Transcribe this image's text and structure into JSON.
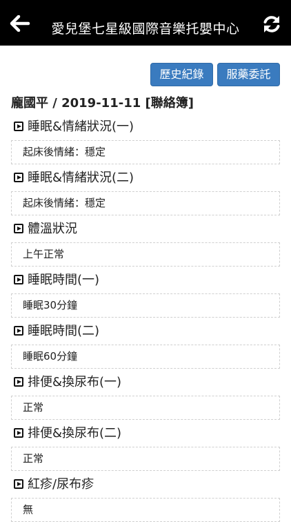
{
  "header": {
    "title": "愛兒堡七星級國際音樂托嬰中心",
    "back_icon": "arrow-left-icon",
    "refresh_icon": "refresh-icon"
  },
  "actions": {
    "history_label": "歷史紀錄",
    "medicine_label": "服藥委託"
  },
  "record": {
    "heading": "龐國平 / 2019-11-11 [聯絡簿]"
  },
  "sections": [
    {
      "title": "睡眠&情緒狀況(一)",
      "value": "起床後情緒：穩定"
    },
    {
      "title": "睡眠&情緒狀況(二)",
      "value": "起床後情緒：穩定"
    },
    {
      "title": "體溫狀況",
      "value": "上午正常"
    },
    {
      "title": "睡眠時間(一)",
      "value": "睡眠30分鐘"
    },
    {
      "title": "睡眠時間(二)",
      "value": "睡眠60分鐘"
    },
    {
      "title": "排便&換尿布(一)",
      "value": "正常"
    },
    {
      "title": "排便&換尿布(二)",
      "value": "正常"
    },
    {
      "title": "紅疹/尿布疹",
      "value": "無"
    }
  ],
  "colors": {
    "topbar": "#000000",
    "button": "#3a7bbf"
  }
}
